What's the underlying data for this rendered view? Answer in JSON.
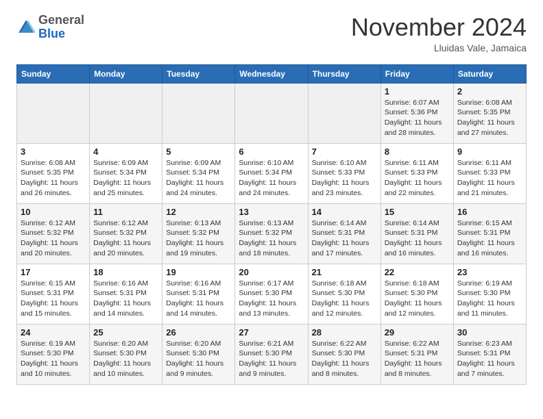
{
  "logo": {
    "general": "General",
    "blue": "Blue"
  },
  "header": {
    "month": "November 2024",
    "location": "Lluidas Vale, Jamaica"
  },
  "weekdays": [
    "Sunday",
    "Monday",
    "Tuesday",
    "Wednesday",
    "Thursday",
    "Friday",
    "Saturday"
  ],
  "weeks": [
    [
      {
        "day": "",
        "info": ""
      },
      {
        "day": "",
        "info": ""
      },
      {
        "day": "",
        "info": ""
      },
      {
        "day": "",
        "info": ""
      },
      {
        "day": "",
        "info": ""
      },
      {
        "day": "1",
        "info": "Sunrise: 6:07 AM\nSunset: 5:36 PM\nDaylight: 11 hours\nand 28 minutes."
      },
      {
        "day": "2",
        "info": "Sunrise: 6:08 AM\nSunset: 5:35 PM\nDaylight: 11 hours\nand 27 minutes."
      }
    ],
    [
      {
        "day": "3",
        "info": "Sunrise: 6:08 AM\nSunset: 5:35 PM\nDaylight: 11 hours\nand 26 minutes."
      },
      {
        "day": "4",
        "info": "Sunrise: 6:09 AM\nSunset: 5:34 PM\nDaylight: 11 hours\nand 25 minutes."
      },
      {
        "day": "5",
        "info": "Sunrise: 6:09 AM\nSunset: 5:34 PM\nDaylight: 11 hours\nand 24 minutes."
      },
      {
        "day": "6",
        "info": "Sunrise: 6:10 AM\nSunset: 5:34 PM\nDaylight: 11 hours\nand 24 minutes."
      },
      {
        "day": "7",
        "info": "Sunrise: 6:10 AM\nSunset: 5:33 PM\nDaylight: 11 hours\nand 23 minutes."
      },
      {
        "day": "8",
        "info": "Sunrise: 6:11 AM\nSunset: 5:33 PM\nDaylight: 11 hours\nand 22 minutes."
      },
      {
        "day": "9",
        "info": "Sunrise: 6:11 AM\nSunset: 5:33 PM\nDaylight: 11 hours\nand 21 minutes."
      }
    ],
    [
      {
        "day": "10",
        "info": "Sunrise: 6:12 AM\nSunset: 5:32 PM\nDaylight: 11 hours\nand 20 minutes."
      },
      {
        "day": "11",
        "info": "Sunrise: 6:12 AM\nSunset: 5:32 PM\nDaylight: 11 hours\nand 20 minutes."
      },
      {
        "day": "12",
        "info": "Sunrise: 6:13 AM\nSunset: 5:32 PM\nDaylight: 11 hours\nand 19 minutes."
      },
      {
        "day": "13",
        "info": "Sunrise: 6:13 AM\nSunset: 5:32 PM\nDaylight: 11 hours\nand 18 minutes."
      },
      {
        "day": "14",
        "info": "Sunrise: 6:14 AM\nSunset: 5:31 PM\nDaylight: 11 hours\nand 17 minutes."
      },
      {
        "day": "15",
        "info": "Sunrise: 6:14 AM\nSunset: 5:31 PM\nDaylight: 11 hours\nand 16 minutes."
      },
      {
        "day": "16",
        "info": "Sunrise: 6:15 AM\nSunset: 5:31 PM\nDaylight: 11 hours\nand 16 minutes."
      }
    ],
    [
      {
        "day": "17",
        "info": "Sunrise: 6:15 AM\nSunset: 5:31 PM\nDaylight: 11 hours\nand 15 minutes."
      },
      {
        "day": "18",
        "info": "Sunrise: 6:16 AM\nSunset: 5:31 PM\nDaylight: 11 hours\nand 14 minutes."
      },
      {
        "day": "19",
        "info": "Sunrise: 6:16 AM\nSunset: 5:31 PM\nDaylight: 11 hours\nand 14 minutes."
      },
      {
        "day": "20",
        "info": "Sunrise: 6:17 AM\nSunset: 5:30 PM\nDaylight: 11 hours\nand 13 minutes."
      },
      {
        "day": "21",
        "info": "Sunrise: 6:18 AM\nSunset: 5:30 PM\nDaylight: 11 hours\nand 12 minutes."
      },
      {
        "day": "22",
        "info": "Sunrise: 6:18 AM\nSunset: 5:30 PM\nDaylight: 11 hours\nand 12 minutes."
      },
      {
        "day": "23",
        "info": "Sunrise: 6:19 AM\nSunset: 5:30 PM\nDaylight: 11 hours\nand 11 minutes."
      }
    ],
    [
      {
        "day": "24",
        "info": "Sunrise: 6:19 AM\nSunset: 5:30 PM\nDaylight: 11 hours\nand 10 minutes."
      },
      {
        "day": "25",
        "info": "Sunrise: 6:20 AM\nSunset: 5:30 PM\nDaylight: 11 hours\nand 10 minutes."
      },
      {
        "day": "26",
        "info": "Sunrise: 6:20 AM\nSunset: 5:30 PM\nDaylight: 11 hours\nand 9 minutes."
      },
      {
        "day": "27",
        "info": "Sunrise: 6:21 AM\nSunset: 5:30 PM\nDaylight: 11 hours\nand 9 minutes."
      },
      {
        "day": "28",
        "info": "Sunrise: 6:22 AM\nSunset: 5:30 PM\nDaylight: 11 hours\nand 8 minutes."
      },
      {
        "day": "29",
        "info": "Sunrise: 6:22 AM\nSunset: 5:31 PM\nDaylight: 11 hours\nand 8 minutes."
      },
      {
        "day": "30",
        "info": "Sunrise: 6:23 AM\nSunset: 5:31 PM\nDaylight: 11 hours\nand 7 minutes."
      }
    ]
  ]
}
